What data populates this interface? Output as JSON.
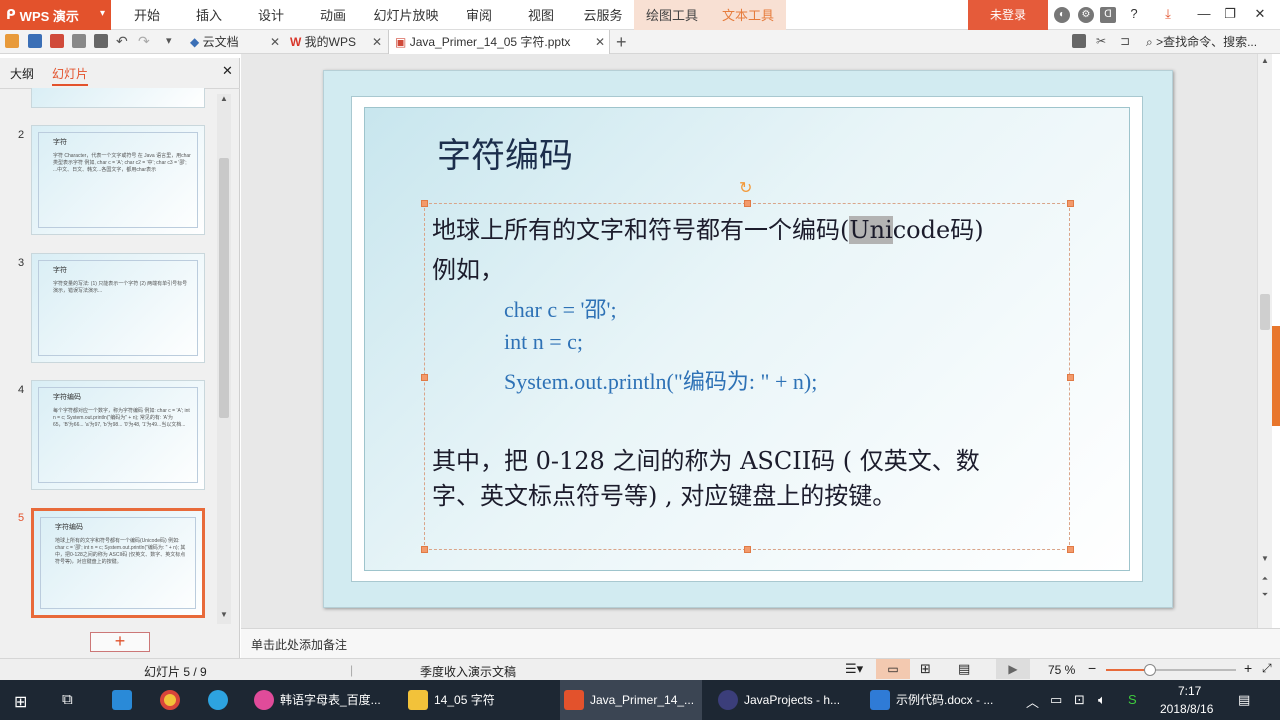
{
  "app": {
    "name": "WPS 演示"
  },
  "menu": {
    "items": [
      "开始",
      "插入",
      "设计",
      "动画",
      "幻灯片放映",
      "审阅",
      "视图",
      "云服务",
      "绘图工具",
      "文本工具"
    ],
    "login": "未登录"
  },
  "tabs": {
    "cloud_docs": "云文档",
    "my_wps": "我的WPS",
    "file": "Java_Primer_14_05 字符.pptx",
    "search": ">查找命令、搜索..."
  },
  "panel": {
    "outline_tab": "大纲",
    "slides_tab": "幻灯片",
    "add_label": "+"
  },
  "thumbnails": [
    {
      "num": "2",
      "title": "字符",
      "body": "字符 Character，代表一个文字或符号 在 Java 语言里，用char类型表示字符 例如, char c = 'A'; char c2 = '中'; char c3 = '邵'; ...中文、日文、韩文...各国文字，都用char表示"
    },
    {
      "num": "3",
      "title": "字符",
      "body": "字符变量的写法: (1) 只能表示一个字符 (2) 两端有单引号标号 演示，错误写法演示..."
    },
    {
      "num": "4",
      "title": "字符编码",
      "body": "每个字符都对应一个数字，称为字符编码 例如: char c = 'A'; int n = c; System.out.println(\"编码为\" + n); 常见的有: 'A'为65，'B'为66... 'a'为97, 'b'为98... '0'为48, '1'为49...当以文档..."
    },
    {
      "num": "5",
      "title": "字符编码",
      "body": "地球上所有的文字和符号都有一个编码(Unicode码) 例如: char c = '邵'; int n = c; System.out.println(\"编码为: \" + n); 其中，把0-128之间的称为 ASCII码 (仅英文、数字、英文标点符号等)，对应键盘上的按键。"
    }
  ],
  "slide": {
    "title": "字符编码",
    "line1_before": "地球上所有的文字和符号都有一个编码(",
    "line1_highlight": "Uni",
    "line1_after": "code码)",
    "line2": "例如，",
    "code1": "char c = '邵';",
    "code2": "int n = c;",
    "code3": "System.out.println(\"编码为: \" + n);",
    "line3": "其中，把 0-128 之间的称为 ASCII码 ( 仅英文、数",
    "line4": "字、英文标点符号等) , 对应键盘上的按键。"
  },
  "notes": {
    "placeholder": "单击此处添加备注"
  },
  "status": {
    "slide_counter": "幻灯片 5 / 9",
    "template": "季度收入演示文稿",
    "zoom": "75 %",
    "zoom_level_percent": 75
  },
  "taskbar": {
    "items": [
      "韩语字母表_百度...",
      "14_05 字符",
      "Java_Primer_14_...",
      "JavaProjects - h...",
      "示例代码.docx - ..."
    ],
    "time": "7:17",
    "date": "2018/8/16"
  },
  "colors": {
    "wps_orange": "#e3522c",
    "code_blue": "#2e72b6",
    "title_navy": "#1c2e4c"
  }
}
